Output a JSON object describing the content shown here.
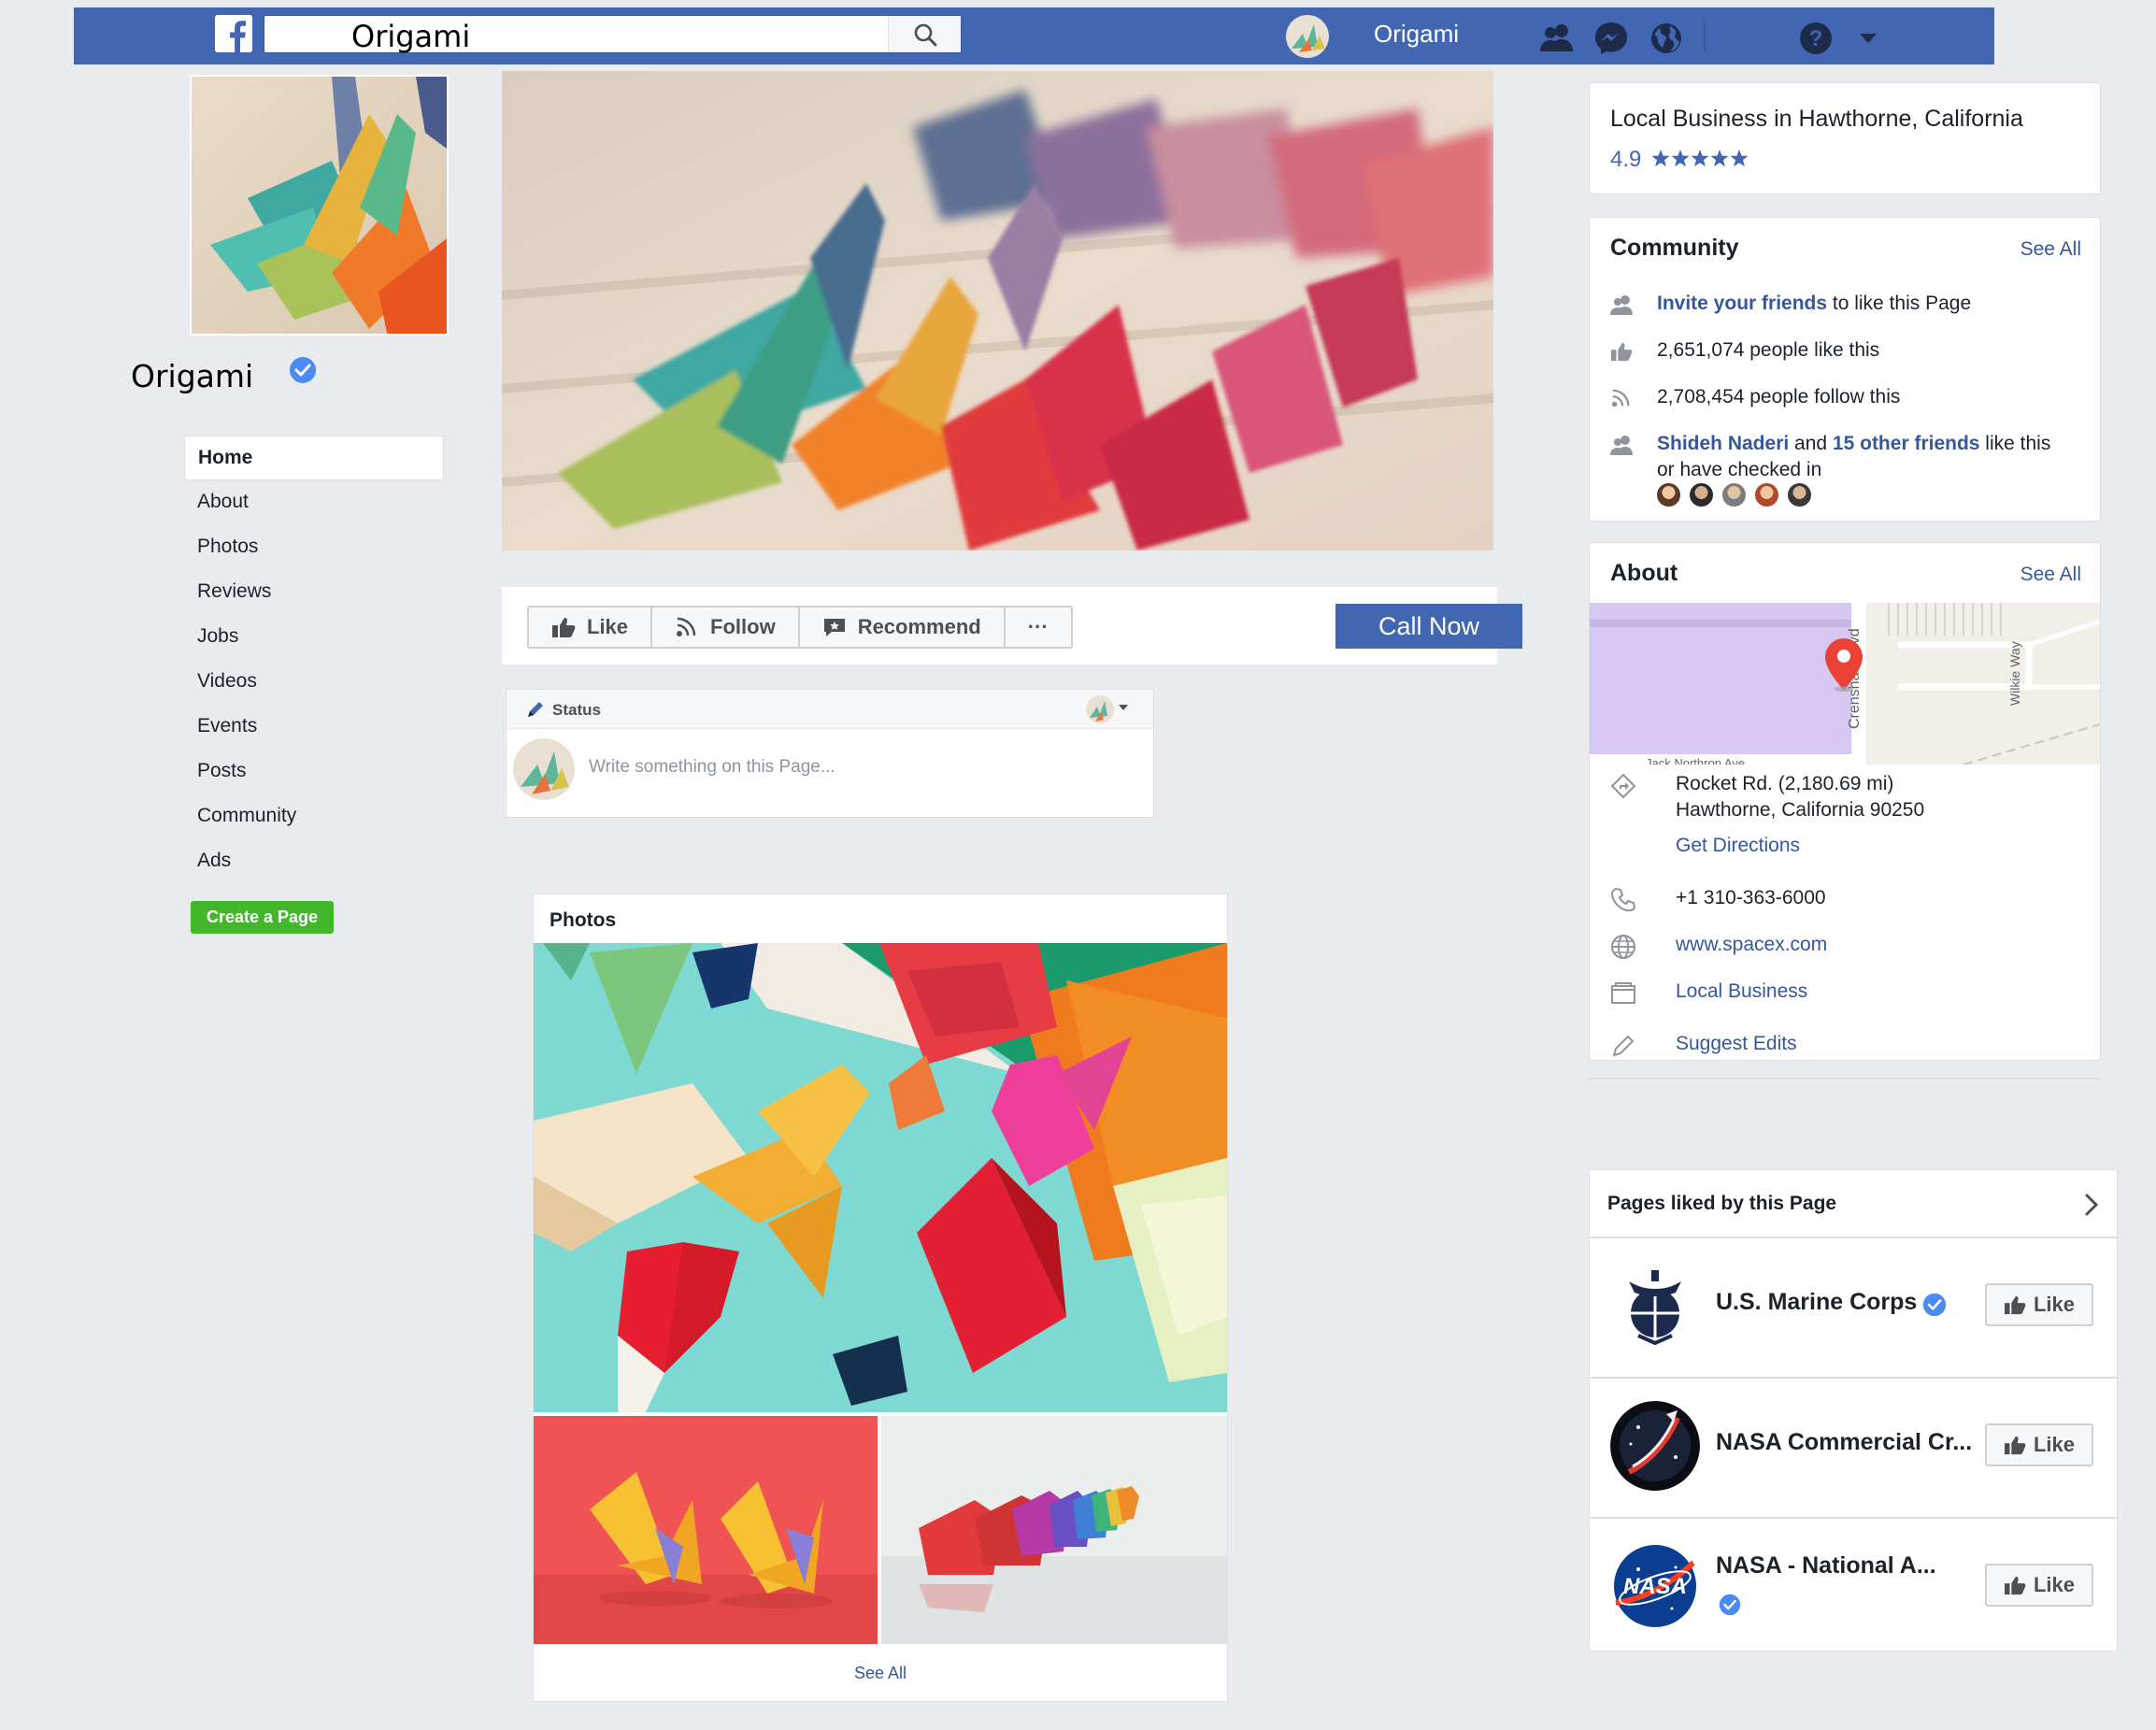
{
  "topbar": {
    "search_value": "Origami",
    "user_name": "Origami",
    "icons": [
      "facebook-logo-icon",
      "search-icon",
      "friends-icon",
      "messenger-icon",
      "globe-icon",
      "help-icon",
      "caret-down-icon"
    ],
    "colors": {
      "bar": "#4267b2"
    }
  },
  "page": {
    "name": "Origami",
    "verified": true
  },
  "nav": {
    "items": [
      {
        "label": "Home"
      },
      {
        "label": "About"
      },
      {
        "label": "Photos"
      },
      {
        "label": "Reviews"
      },
      {
        "label": "Jobs"
      },
      {
        "label": "Videos"
      },
      {
        "label": "Events"
      },
      {
        "label": "Posts"
      },
      {
        "label": "Community"
      },
      {
        "label": "Ads"
      }
    ],
    "active": "Home",
    "create_page": "Create a Page"
  },
  "actions": {
    "like": "Like",
    "follow": "Follow",
    "recommend": "Recommend",
    "more": "···",
    "call_now": "Call Now"
  },
  "composer": {
    "tab_label": "Status",
    "placeholder": "Write something on this Page..."
  },
  "photos": {
    "title": "Photos",
    "see_all": "See All"
  },
  "business": {
    "category": "Local Business in Hawthorne, California",
    "rating": "4.9",
    "stars": 5
  },
  "community": {
    "title": "Community",
    "see_all": "See All",
    "invite_link": "Invite your friends",
    "invite_rest": " to like this Page",
    "likes": "2,651,074 people like this",
    "follows": "2,708,454 people follow this",
    "friend_name": "Shideh Naderi",
    "friends_and": " and ",
    "friends_other": "15 other friends",
    "friends_rest": " like this",
    "friends_line2": "or have checked in"
  },
  "about": {
    "title": "About",
    "see_all": "See All",
    "map_labels": {
      "street1": "Crenshaw Blvd",
      "street2": "Wilkie Way",
      "street3": "Jack Northrop Ave"
    },
    "address_line1": "Rocket Rd. (2,180.69 mi)",
    "address_line2": "Hawthorne, California 90250",
    "directions": "Get Directions",
    "phone": "+1 310-363-6000",
    "website": "www.spacex.com",
    "category": "Local Business",
    "suggest": "Suggest Edits"
  },
  "liked_pages": {
    "title": "Pages liked by this Page",
    "like_label": "Like",
    "items": [
      {
        "name": "U.S. Marine Corps",
        "verified": true
      },
      {
        "name": "NASA Commercial Cr...",
        "verified": false
      },
      {
        "name": "NASA - National A...",
        "verified": true
      }
    ]
  }
}
